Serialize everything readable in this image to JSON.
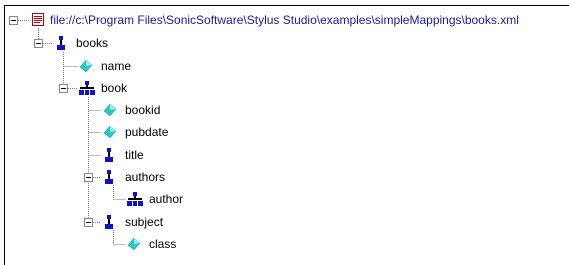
{
  "tree": {
    "root_path": "file://c:\\Program Files\\SonicSoftware\\Stylus Studio\\examples\\simpleMappings\\books.xml",
    "nodes": [
      {
        "label": "books",
        "icon": "element-single-icon",
        "expanded": true
      },
      {
        "label": "name",
        "icon": "attribute-icon"
      },
      {
        "label": "book",
        "icon": "element-repeating-icon",
        "expanded": true
      },
      {
        "label": "bookid",
        "icon": "attribute-icon"
      },
      {
        "label": "pubdate",
        "icon": "attribute-icon"
      },
      {
        "label": "title",
        "icon": "element-single-icon"
      },
      {
        "label": "authors",
        "icon": "element-single-icon",
        "expanded": true
      },
      {
        "label": "author",
        "icon": "element-repeating-icon"
      },
      {
        "label": "subject",
        "icon": "element-single-icon",
        "expanded": true
      },
      {
        "label": "class",
        "icon": "attribute-icon"
      }
    ]
  },
  "colors": {
    "element_blue": "#1010d0",
    "attribute_cyan": "#28c8c8",
    "doc_red": "#c00000"
  }
}
